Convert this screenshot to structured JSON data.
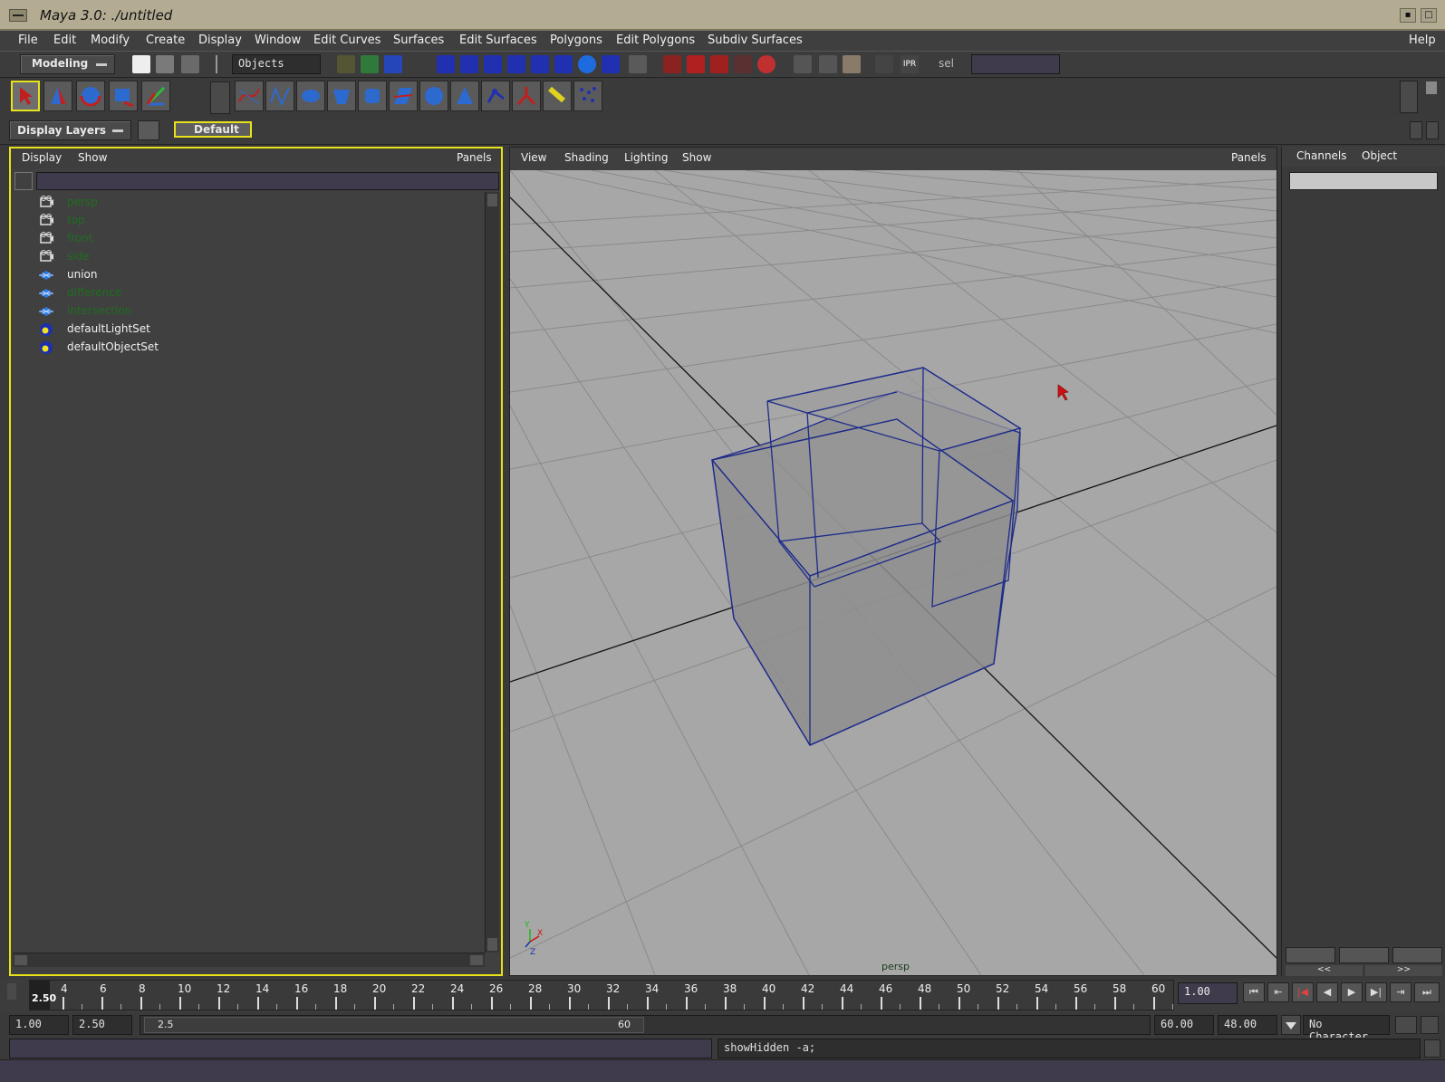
{
  "window": {
    "title": "Maya 3.0: ./untitled"
  },
  "menubar": {
    "items": [
      "File",
      "Edit",
      "Modify",
      "Create",
      "Display",
      "Window",
      "Edit Curves",
      "Surfaces",
      "Edit Surfaces",
      "Polygons",
      "Edit Polygons",
      "Subdiv Surfaces"
    ],
    "help": "Help"
  },
  "toolbar": {
    "menu_set": "Modeling",
    "selection_mode": "Objects",
    "sel_label": "sel"
  },
  "layers": {
    "title": "Display Layers",
    "default_layer": "Default"
  },
  "outliner": {
    "menu": [
      "Display",
      "Show"
    ],
    "panels": "Panels",
    "items": [
      {
        "label": "persp",
        "icon": "camera-icon",
        "hidden": true
      },
      {
        "label": "top",
        "icon": "camera-icon",
        "hidden": true
      },
      {
        "label": "front",
        "icon": "camera-icon",
        "hidden": true
      },
      {
        "label": "side",
        "icon": "camera-icon",
        "hidden": true
      },
      {
        "label": "union",
        "icon": "nurbs-icon",
        "hidden": false
      },
      {
        "label": "difference",
        "icon": "nurbs-icon",
        "hidden": true
      },
      {
        "label": "intersection",
        "icon": "nurbs-icon",
        "hidden": true
      },
      {
        "label": "defaultLightSet",
        "icon": "set-icon",
        "hidden": false
      },
      {
        "label": "defaultObjectSet",
        "icon": "set-icon",
        "hidden": false
      }
    ]
  },
  "viewport": {
    "menu": [
      "View",
      "Shading",
      "Lighting",
      "Show"
    ],
    "panels": "Panels",
    "camera_label": "persp",
    "axis": {
      "x": "X",
      "y": "Y",
      "z": "Z"
    }
  },
  "channels": {
    "tabs": [
      "Channels",
      "Object"
    ],
    "prev": "<<",
    "next": ">>"
  },
  "timeline": {
    "ticks": [
      "4",
      "6",
      "8",
      "10",
      "12",
      "14",
      "16",
      "18",
      "20",
      "22",
      "24",
      "26",
      "28",
      "30",
      "32",
      "34",
      "36",
      "38",
      "40",
      "42",
      "44",
      "46",
      "48",
      "50",
      "52",
      "54",
      "56",
      "58",
      "60"
    ],
    "current_marker": "2.50",
    "current_time": "1.00"
  },
  "range": {
    "start": "1.00",
    "current": "2.50",
    "slider_start": "2.5",
    "slider_end": "60",
    "end": "60.00",
    "playback_end": "48.00",
    "character": "No Character"
  },
  "command": {
    "output": "showHidden -a;"
  },
  "colors": {
    "hidden_text": "#1f6e1f",
    "yellow_highlight": "#e7e21a",
    "viewport_bg": "#a7a7a7"
  }
}
